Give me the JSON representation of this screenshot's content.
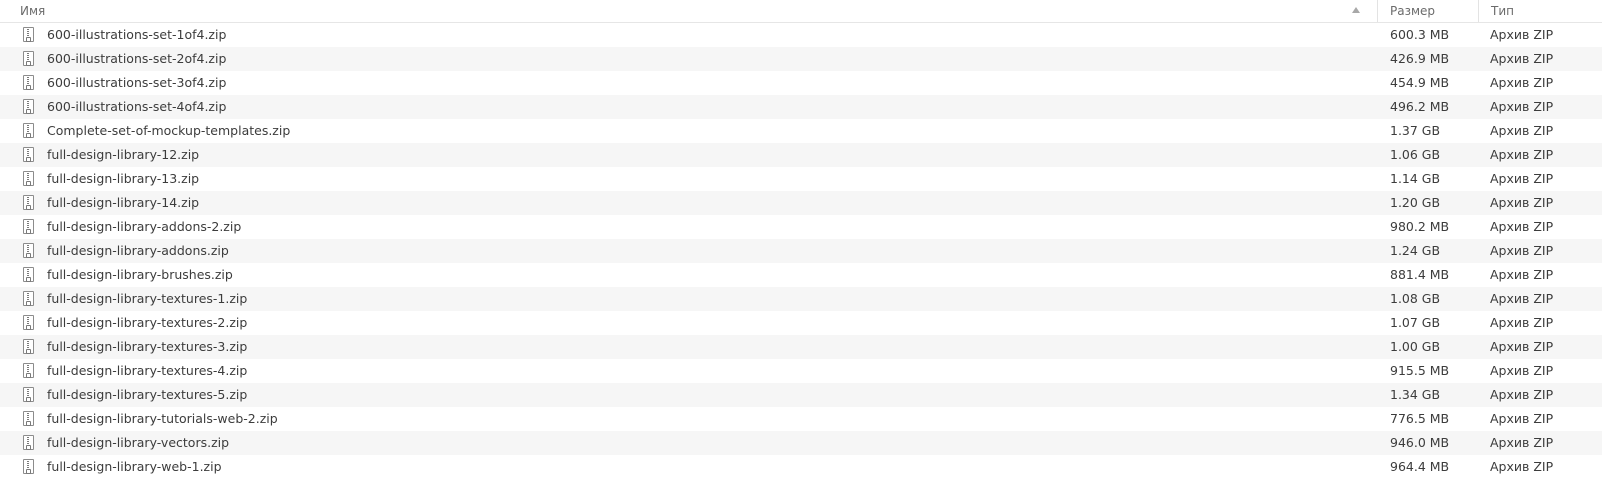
{
  "columns": {
    "name": "Имя",
    "size": "Размер",
    "type": "Тип"
  },
  "sort_icon": "sort-ascending-icon",
  "file_icon": "zip-archive-icon",
  "files": [
    {
      "name": "600-illustrations-set-1of4.zip",
      "size": "600.3 MB",
      "type": "Архив ZIP"
    },
    {
      "name": "600-illustrations-set-2of4.zip",
      "size": "426.9 MB",
      "type": "Архив ZIP"
    },
    {
      "name": "600-illustrations-set-3of4.zip",
      "size": "454.9 MB",
      "type": "Архив ZIP"
    },
    {
      "name": "600-illustrations-set-4of4.zip",
      "size": "496.2 MB",
      "type": "Архив ZIP"
    },
    {
      "name": "Complete-set-of-mockup-templates.zip",
      "size": "1.37 GB",
      "type": "Архив ZIP"
    },
    {
      "name": "full-design-library-12.zip",
      "size": "1.06 GB",
      "type": "Архив ZIP"
    },
    {
      "name": "full-design-library-13.zip",
      "size": "1.14 GB",
      "type": "Архив ZIP"
    },
    {
      "name": "full-design-library-14.zip",
      "size": "1.20 GB",
      "type": "Архив ZIP"
    },
    {
      "name": "full-design-library-addons-2.zip",
      "size": "980.2 MB",
      "type": "Архив ZIP"
    },
    {
      "name": "full-design-library-addons.zip",
      "size": "1.24 GB",
      "type": "Архив ZIP"
    },
    {
      "name": "full-design-library-brushes.zip",
      "size": "881.4 MB",
      "type": "Архив ZIP"
    },
    {
      "name": "full-design-library-textures-1.zip",
      "size": "1.08 GB",
      "type": "Архив ZIP"
    },
    {
      "name": "full-design-library-textures-2.zip",
      "size": "1.07 GB",
      "type": "Архив ZIP"
    },
    {
      "name": "full-design-library-textures-3.zip",
      "size": "1.00 GB",
      "type": "Архив ZIP"
    },
    {
      "name": "full-design-library-textures-4.zip",
      "size": "915.5 MB",
      "type": "Архив ZIP"
    },
    {
      "name": "full-design-library-textures-5.zip",
      "size": "1.34 GB",
      "type": "Архив ZIP"
    },
    {
      "name": "full-design-library-tutorials-web-2.zip",
      "size": "776.5 MB",
      "type": "Архив ZIP"
    },
    {
      "name": "full-design-library-vectors.zip",
      "size": "946.0 MB",
      "type": "Архив ZIP"
    },
    {
      "name": "full-design-library-web-1.zip",
      "size": "964.4 MB",
      "type": "Архив ZIP"
    }
  ]
}
